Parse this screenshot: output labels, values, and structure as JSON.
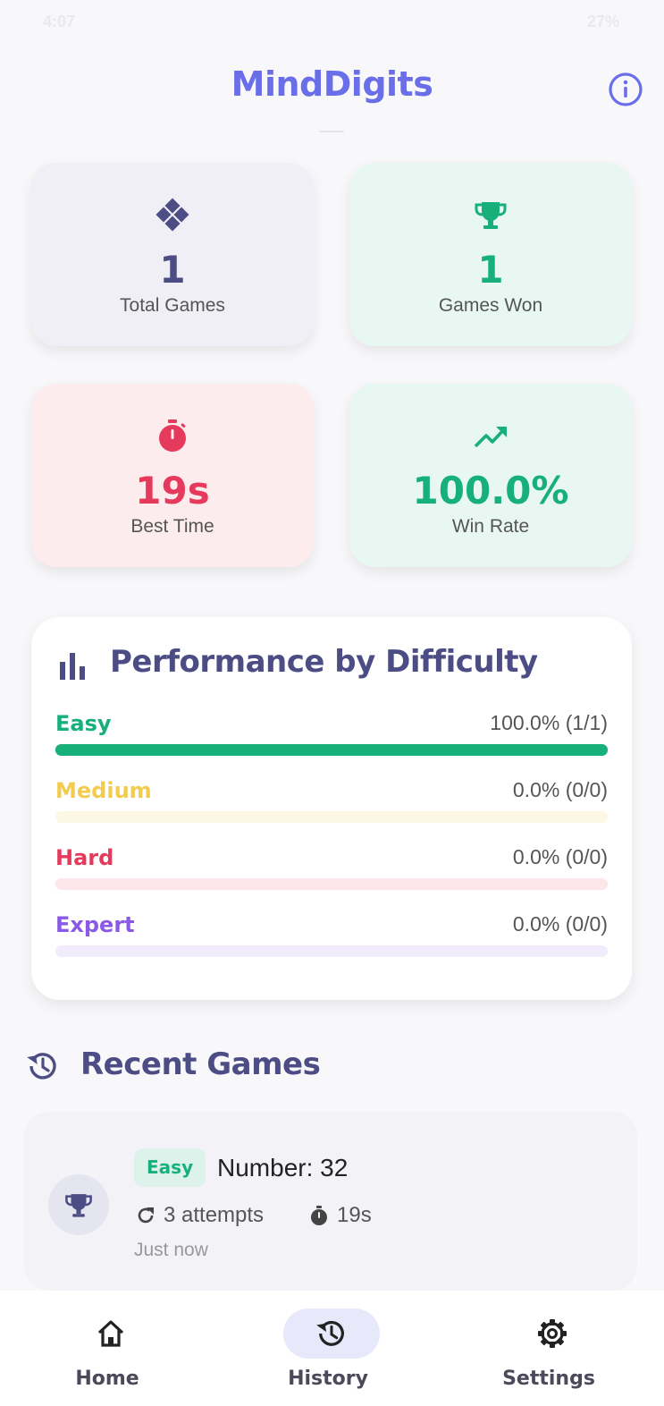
{
  "status_bar": {
    "time": "4:07",
    "battery": "27%"
  },
  "app": {
    "title": "MindDigits"
  },
  "stats": {
    "total_games": {
      "value": "1",
      "label": "Total Games",
      "icon": "gamepad-icon"
    },
    "games_won": {
      "value": "1",
      "label": "Games Won",
      "icon": "trophy-icon"
    },
    "best_time": {
      "value": "19s",
      "label": "Best Time",
      "icon": "stopwatch-icon"
    },
    "win_rate": {
      "value": "100.0%",
      "label": "Win Rate",
      "icon": "trending-up-icon"
    }
  },
  "performance": {
    "title": "Performance by Difficulty",
    "rows": [
      {
        "name": "Easy",
        "stat": "100.0% (1/1)",
        "fraction": 1.0,
        "color": "#17b07a",
        "track": "#17b07a"
      },
      {
        "name": "Medium",
        "stat": "0.0% (0/0)",
        "fraction": 0.0,
        "color": "#f2cc4e",
        "track": "#fdf8e6"
      },
      {
        "name": "Hard",
        "stat": "0.0% (0/0)",
        "fraction": 0.0,
        "color": "#e63a5c",
        "track": "#fde6ea"
      },
      {
        "name": "Expert",
        "stat": "0.0% (0/0)",
        "fraction": 0.0,
        "color": "#8a5ae6",
        "track": "#f0ecfc"
      }
    ]
  },
  "recent": {
    "title": "Recent Games",
    "games": [
      {
        "difficulty": "Easy",
        "number_text": "Number: 32",
        "attempts": "3 attempts",
        "time": "19s",
        "when": "Just now"
      }
    ]
  },
  "nav": {
    "items": [
      {
        "label": "Home",
        "icon": "home-icon",
        "active": false
      },
      {
        "label": "History",
        "icon": "history-icon",
        "active": true
      },
      {
        "label": "Settings",
        "icon": "gear-icon",
        "active": false
      }
    ]
  },
  "colors": {
    "brand": "#6a6ee8",
    "heading": "#4b4d84",
    "success": "#17b07a",
    "danger": "#e63a5c"
  }
}
